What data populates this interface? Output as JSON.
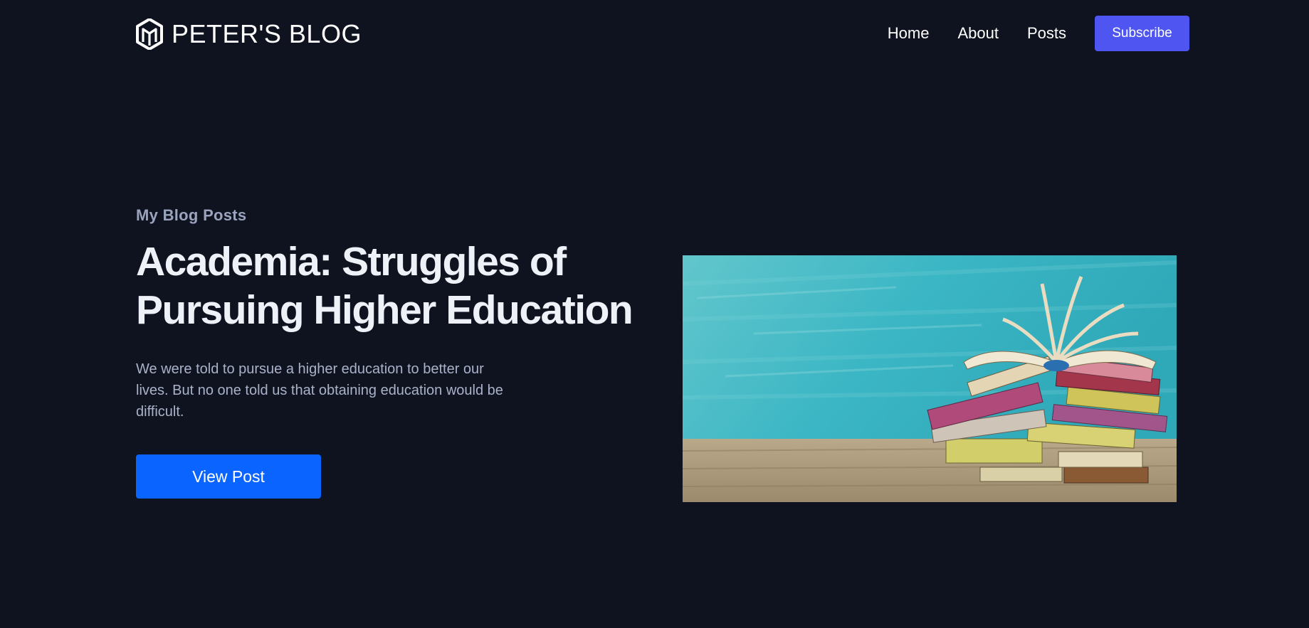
{
  "header": {
    "brand_name": "PETER'S BLOG",
    "nav": [
      {
        "label": "Home"
      },
      {
        "label": "About"
      },
      {
        "label": "Posts"
      }
    ],
    "subscribe_label": "Subscribe"
  },
  "hero": {
    "eyebrow": "My Blog Posts",
    "title_line1": "Academia: Struggles of",
    "title_line2": "Pursuing Higher Education",
    "description": "We were told to pursue a higher education to better our lives. But no one told us that obtaining education would be difficult.",
    "button_label": "View Post"
  },
  "colors": {
    "background": "#0f1320",
    "accent_subscribe": "#4f55f0",
    "accent_primary": "#0a64ff",
    "muted_text": "#9aa4bd"
  },
  "icons": {
    "brand": "hexagon-m-logo-icon"
  }
}
